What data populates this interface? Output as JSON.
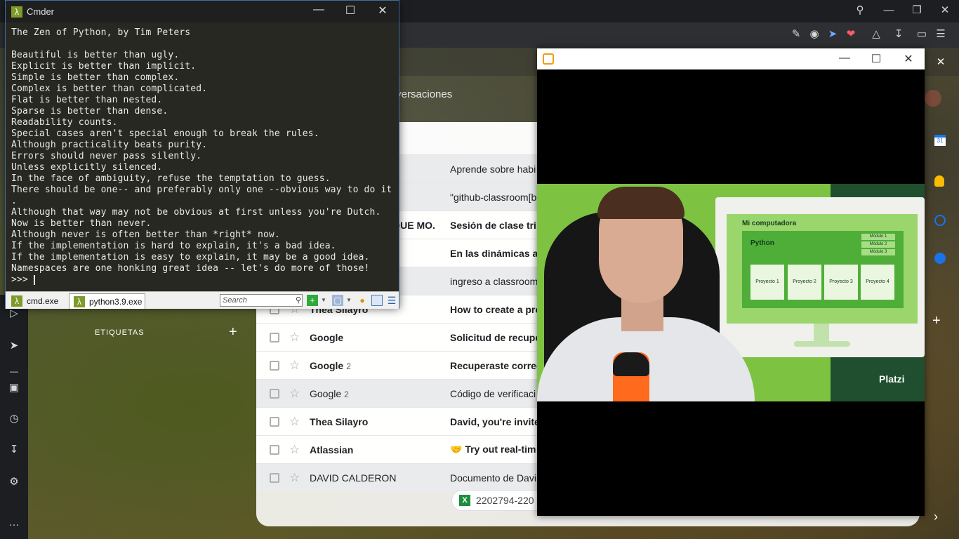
{
  "cmder": {
    "title": "Cmder",
    "lines": [
      "The Zen of Python, by Tim Peters",
      "",
      "Beautiful is better than ugly.",
      "Explicit is better than implicit.",
      "Simple is better than complex.",
      "Complex is better than complicated.",
      "Flat is better than nested.",
      "Sparse is better than dense.",
      "Readability counts.",
      "Special cases aren't special enough to break the rules.",
      "Although practicality beats purity.",
      "Errors should never pass silently.",
      "Unless explicitly silenced.",
      "In the face of ambiguity, refuse the temptation to guess.",
      "There should be one-- and preferably only one --obvious way to do it",
      ".",
      "Although that way may not be obvious at first unless you're Dutch.",
      "Now is better than never.",
      "Although never is often better than *right* now.",
      "If the implementation is hard to explain, it's a bad idea.",
      "If the implementation is easy to explain, it may be a good idea.",
      "Namespaces are one honking great idea -- let's do more of those!"
    ],
    "prompt": ">>> ",
    "tabs": [
      "cmd.exe",
      "python3.9.exe"
    ],
    "search_placeholder": "Search"
  },
  "gmail": {
    "search_text": "conversaciones",
    "labels_heading": "ETIQUETAS",
    "rows": [
      {
        "sender": "",
        "count": "",
        "subject": "Aprende sobre habi",
        "unread": false
      },
      {
        "sender": "",
        "count": "",
        "subject": "\"github-classroom[b",
        "unread": false
      },
      {
        "sender": "HERNANDO ENRIQUE MO.",
        "count": "",
        "subject": "Sesión de clase tri",
        "unread": true
      },
      {
        "sender": "",
        "count": "",
        "subject": "En las dinámicas ac",
        "unread": true
      },
      {
        "sender": "",
        "count": "",
        "subject": "ingreso a classroom",
        "unread": false
      },
      {
        "sender": "Thea Silayro",
        "count": "",
        "subject": "How to create a pro",
        "unread": true
      },
      {
        "sender": "Google",
        "count": "",
        "subject": "Solicitud de recupe",
        "unread": true
      },
      {
        "sender": "Google",
        "count": "2",
        "subject": "Recuperaste correo",
        "unread": true
      },
      {
        "sender": "Google",
        "count": "2",
        "subject": "Código de verificaci",
        "unread": false
      },
      {
        "sender": "Thea Silayro",
        "count": "",
        "subject": "David, you're invite",
        "unread": true
      },
      {
        "sender": "Atlassian",
        "count": "",
        "subject": "🤝 Try out real-tim",
        "unread": true
      },
      {
        "sender": "DAVID CALDERON",
        "count": "",
        "subject": "Documento de Davi",
        "unread": false
      }
    ],
    "attachment": "2202794-220"
  },
  "video": {
    "slide_title": "Mi computadora",
    "python_label": "Python",
    "modules": [
      "Módulo 1",
      "Módulo 2",
      "Módulo 3"
    ],
    "projects": [
      "Proyecto 1",
      "Proyecto 2",
      "Proyecto 3",
      "Proyecto 4"
    ],
    "brand": "Platzi"
  },
  "colors": {
    "terminal_bg": "#272822",
    "accent_green": "#7ec242",
    "window_border": "#3c6f9e"
  }
}
